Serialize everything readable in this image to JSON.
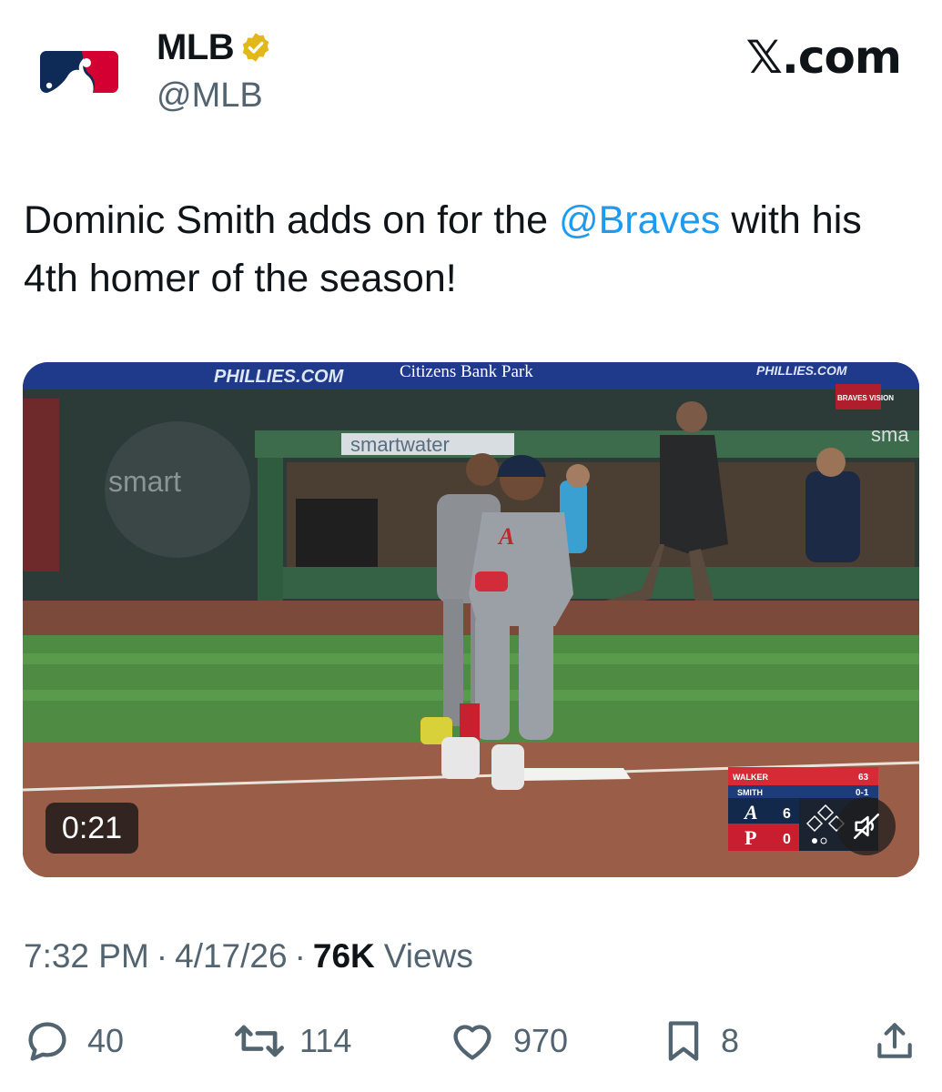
{
  "author": {
    "display_name": "MLB",
    "handle": "@MLB",
    "verified_color": "#e2b719",
    "logo_colors": {
      "blue": "#0d2b56",
      "red": "#d50032"
    }
  },
  "site": {
    "mark": "𝕏.com"
  },
  "tweet": {
    "text_before": "Dominic Smith adds on for the ",
    "mention": "@Braves",
    "text_after": " with his 4th homer of the season!",
    "mention_color": "#1d9bf0"
  },
  "video": {
    "duration": "0:21",
    "signage": {
      "banner_1": "PHILLIES.COM",
      "banner_2": "Citizens Bank Park",
      "sign_left": "smart",
      "sign_center": "smartwater",
      "sign_right": "sma",
      "network": "BRAVES VISION"
    },
    "scorebug": {
      "pitcher": "WALKER",
      "pitch_count": "63",
      "batter": "SMITH",
      "count": "0-1",
      "team_1_logo": "A",
      "team_1_score": "6",
      "team_2_logo": "P",
      "team_2_score": "0"
    },
    "mute_icon": "speaker-muted-icon"
  },
  "meta": {
    "time": "7:32 PM",
    "date": "4/17/26",
    "views_count": "76K",
    "views_label": "Views",
    "separator": "·"
  },
  "actions": {
    "replies": "40",
    "reposts": "114",
    "likes": "970",
    "bookmarks": "8",
    "icons": [
      "reply-icon",
      "repost-icon",
      "like-icon",
      "bookmark-icon",
      "share-icon"
    ]
  }
}
